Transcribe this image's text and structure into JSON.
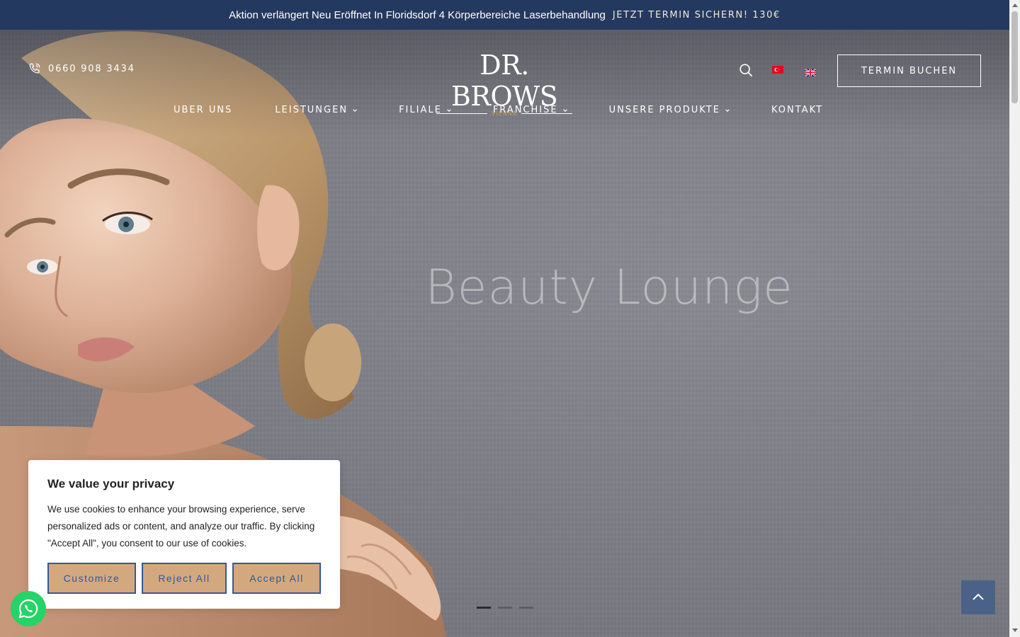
{
  "announcement": {
    "promo": "Aktion verlängert Neu Eröffnet In Floridsdorf 4 Körperbereiche Laserbehandlung",
    "cta": "JETZT TERMIN SICHERN! 130€"
  },
  "header": {
    "phone": "0660 908 3434",
    "logo_word": "DR. BROWS",
    "logo_city": "VIENNA",
    "book_label": "TERMIN BUCHEN",
    "languages": [
      "tr",
      "en"
    ]
  },
  "nav": {
    "items": [
      {
        "label": "UBER UNS",
        "dropdown": false
      },
      {
        "label": "LEISTUNGEN",
        "dropdown": true
      },
      {
        "label": "FILIALE",
        "dropdown": true
      },
      {
        "label": "FRANCHISE",
        "dropdown": true
      },
      {
        "label": "UNSERE PRODUKTE",
        "dropdown": true
      },
      {
        "label": "KONTAKT",
        "dropdown": false
      }
    ]
  },
  "hero": {
    "headline": "Beauty Lounge",
    "slides_total": 3,
    "active_slide": 1
  },
  "cookie": {
    "title": "We value your privacy",
    "body": "We use cookies to enhance your browsing experience, serve personalized ads or content, and analyze our traffic. By clicking \"Accept All\", you consent to our use of cookies.",
    "customize": "Customize",
    "reject": "Reject All",
    "accept": "Accept All"
  },
  "colors": {
    "topbar_bg": "#24395f",
    "cookie_button_bg": "#d4a87f",
    "cookie_button_border": "#2f5a9c",
    "logo_accent": "#c8a24a",
    "whatsapp": "#25d366",
    "totop_bg": "#4a6287"
  },
  "icons": [
    "phone-icon",
    "search-icon",
    "chevron-down-icon",
    "whatsapp-icon",
    "chevron-up-icon",
    "flag-turkey-icon",
    "flag-uk-icon"
  ]
}
